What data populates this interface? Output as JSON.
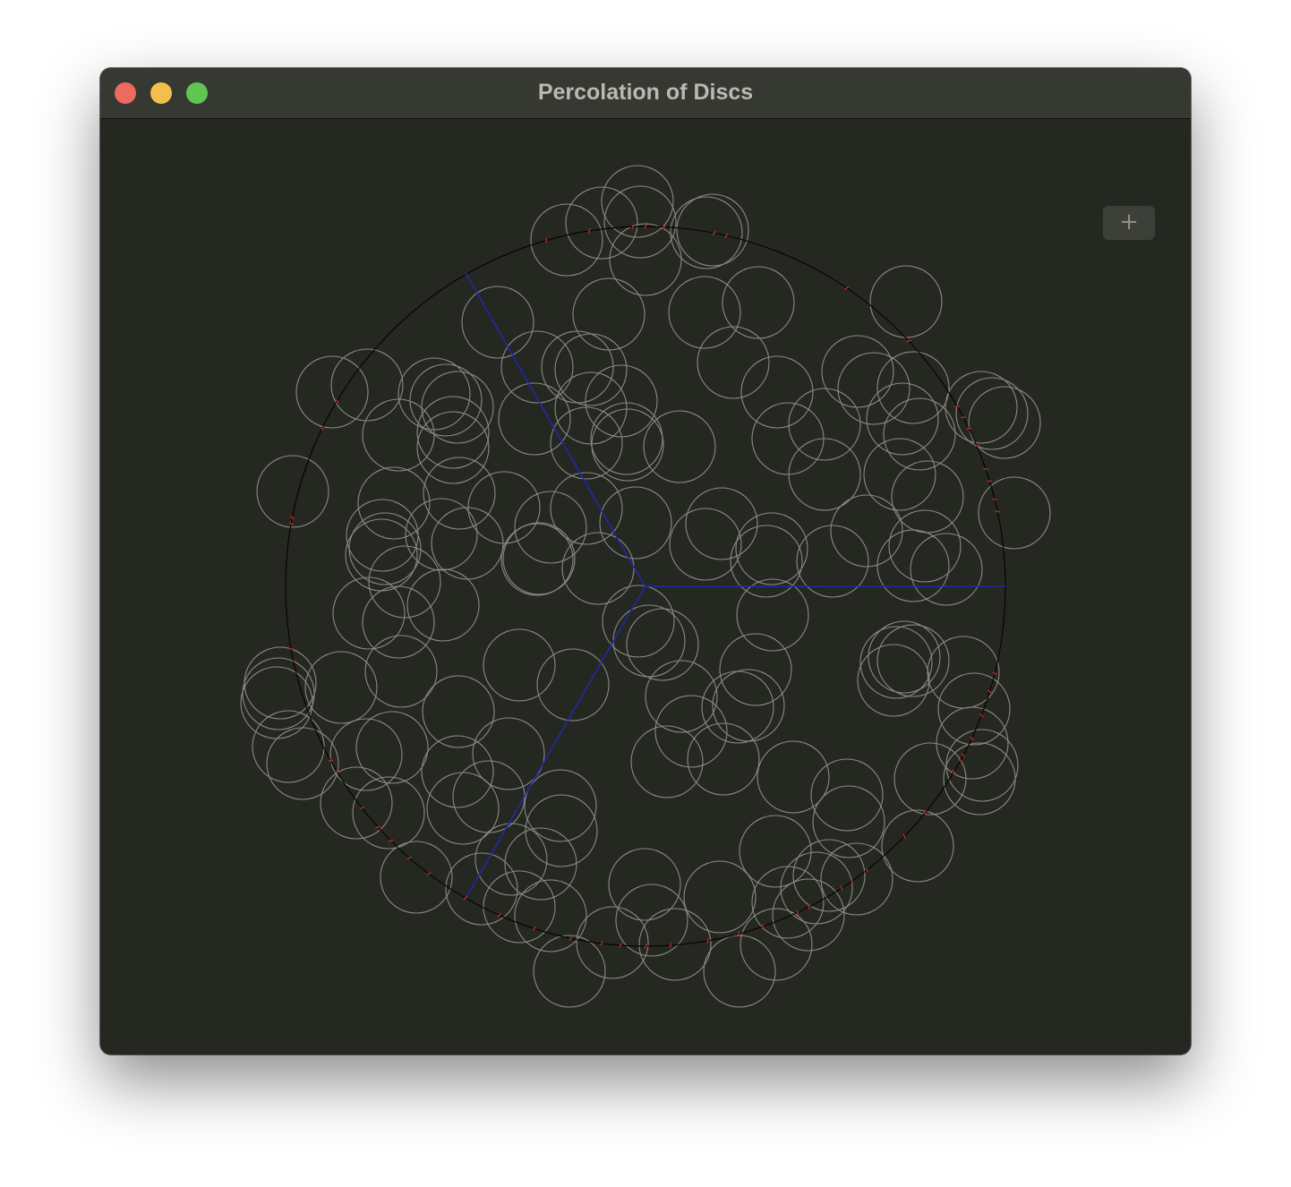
{
  "window": {
    "title": "Percolation of Discs"
  },
  "toolbar": {
    "add_label": "+",
    "add_icon": "plus-icon"
  },
  "colors": {
    "window_bg": "#252721",
    "titlebar_bg": "#363832",
    "disc_stroke": "#8a8a86",
    "boundary_stroke": "#050505",
    "cut_lines": "#1f2aa8",
    "crossing_marks": "#c0281e",
    "close": "#ed6a5e",
    "minimize": "#f4be4f",
    "zoom": "#61c554"
  }
}
